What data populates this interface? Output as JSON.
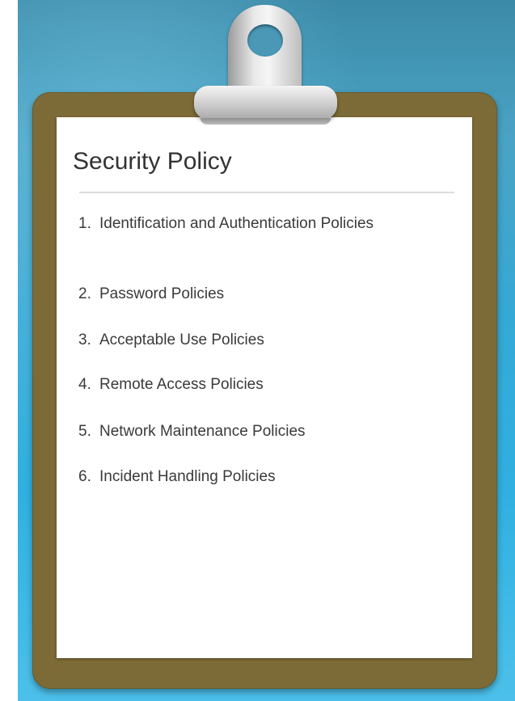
{
  "clipboard": {
    "title": "Security Policy",
    "items": [
      {
        "number": "1.",
        "label": "Identification and Authentication Policies"
      },
      {
        "number": "2.",
        "label": "Password Policies"
      },
      {
        "number": "3.",
        "label": "Acceptable Use Policies"
      },
      {
        "number": "4.",
        "label": "Remote Access Policies"
      },
      {
        "number": "5.",
        "label": "Network Maintenance Policies"
      },
      {
        "number": "6.",
        "label": "Incident Handling Policies"
      }
    ]
  },
  "colors": {
    "board": "#7c6b37",
    "paper": "#ffffff",
    "background": "#35a9d6",
    "text": "#333333"
  }
}
